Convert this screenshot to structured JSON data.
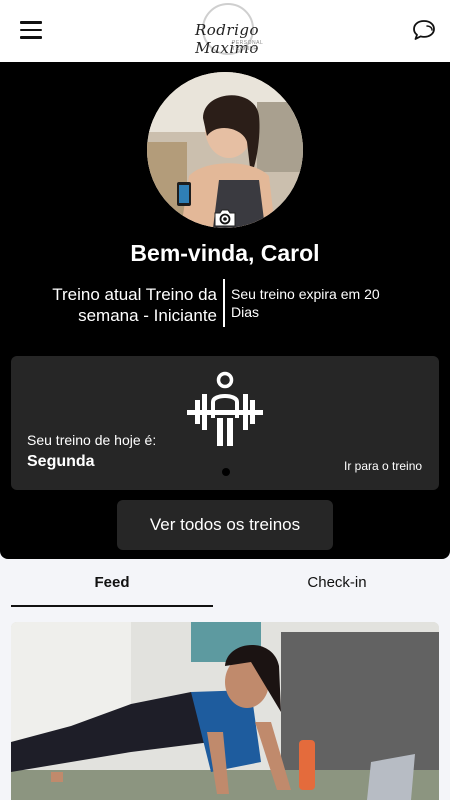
{
  "header": {
    "logo_text": "Rodrigo Maximo",
    "logo_subtitle": "PERSONAL TRAINER",
    "menu_icon": "hamburger-menu-icon",
    "chat_icon": "chat-bubbles-icon"
  },
  "profile": {
    "welcome": "Bem-vinda, Carol",
    "workout_name": "Treino atual Treino da semana - Iniciante",
    "expiry_text": "Seu treino expira em 20 Dias",
    "camera_icon": "camera-icon"
  },
  "today": {
    "label": "Seu treino de hoje é:",
    "day": "Segunda",
    "link": "Ir para o treino",
    "icon": "weightlifter-icon"
  },
  "actions": {
    "all_workouts": "Ver todos os treinos"
  },
  "tabs": [
    {
      "label": "Feed",
      "active": true
    },
    {
      "label": "Check-in",
      "active": false
    }
  ],
  "colors": {
    "hero_bg": "#000000",
    "card_bg": "#262626",
    "page_bg": "#f4f5f9"
  }
}
